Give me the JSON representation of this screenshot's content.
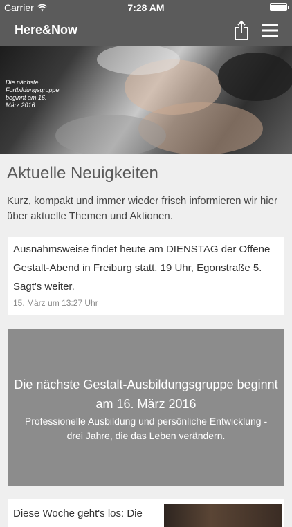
{
  "status_bar": {
    "carrier": "Carrier",
    "time": "7:28 AM"
  },
  "navbar": {
    "title": "Here&Now",
    "share_icon": "share-icon",
    "menu_icon": "hamburger-menu-icon"
  },
  "hero": {
    "caption": "Die nächste Fortbildungsgruppe beginnt am 16. März 2016"
  },
  "news": {
    "title": "Aktuelle Neuigkeiten",
    "intro": "Kurz, kompakt und immer wieder frisch informieren wir hier über aktuelle Themen und Aktionen.",
    "post": {
      "text": "Ausnahmsweise findet heute am DIENSTAG der Offene Gestalt-Abend in Freiburg statt. 19 Uhr, Egonstraße 5. Sagt's weiter.",
      "time": "15. März um 13:27 Uhr"
    }
  },
  "promo": {
    "headline": "Die nächste Gestalt-Ausbildungsgruppe beginnt am 16. März 2016",
    "subtitle": "Professionelle Ausbildung und persönliche Entwicklung - drei Jahre, die das Leben verändern."
  },
  "next_card": {
    "text": "Diese Woche geht's los: Die"
  },
  "colors": {
    "bar": "#5b5b5b",
    "background": "#efefef",
    "promo": "#8c8c8c"
  }
}
